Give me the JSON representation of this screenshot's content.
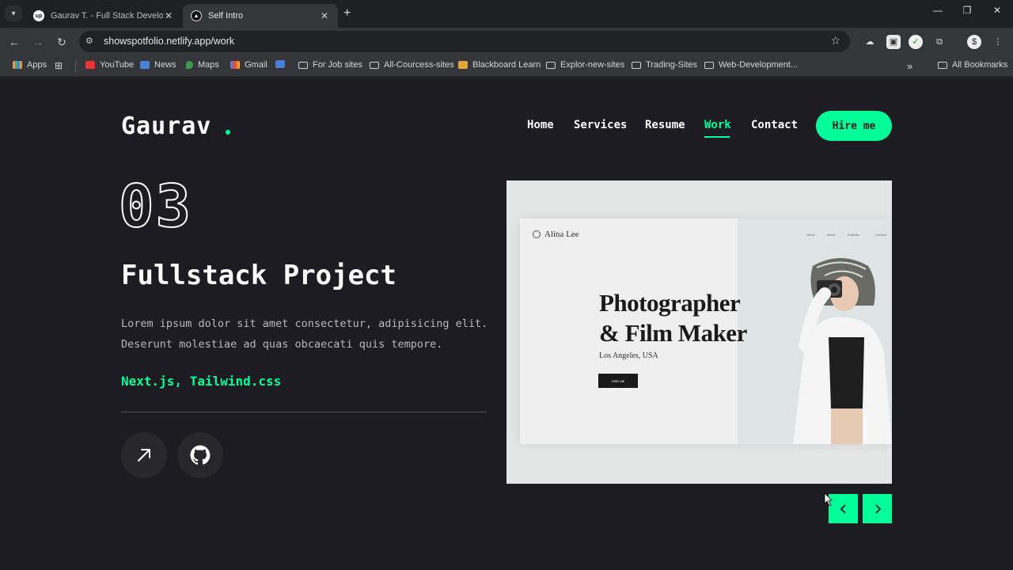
{
  "browser": {
    "tabs": [
      {
        "title": "Gaurav T. - Full Stack Developer",
        "favicon": "upwork-icon"
      },
      {
        "title": "Self Intro",
        "favicon": "nextjs-icon"
      }
    ],
    "url": "showspotfolio.netlify.app/work",
    "bookmarks": {
      "apps": "Apps",
      "youtube": "YouTube",
      "news": "News",
      "maps": "Maps",
      "gmail": "Gmail",
      "job_sites": "For Job sites",
      "courses": "All-Courcess-sites",
      "blackboard": "Blackboard Learn",
      "explore": "Explor-new-sites",
      "trading": "Trading-Sites",
      "webdev": "Web-Development...",
      "all": "All Bookmarks",
      "more": "»"
    }
  },
  "site": {
    "logo": "Gaurav",
    "nav": {
      "home": "Home",
      "services": "Services",
      "resume": "Resume",
      "work": "Work",
      "contact": "Contact"
    },
    "hire_label": "Hire me",
    "accent": "#00ff99",
    "background": "#1c1c22"
  },
  "project": {
    "number": "03",
    "title": "Fullstack Project",
    "description_line1": "Lorem ipsum dolor sit amet consectetur, adipisicing elit.",
    "description_line2": "Deserunt molestiae ad quas obcaecati quis tempore.",
    "stack": "Next.js, Tailwind.css"
  },
  "preview": {
    "brand": "Alina Lee",
    "menu": [
      "Home",
      "About",
      "Portfolio",
      "Contact"
    ],
    "headline_line1": "Photographer",
    "headline_line2": "& Film Maker",
    "location": "Los Angeles, USA",
    "button": "HIRE ME"
  }
}
